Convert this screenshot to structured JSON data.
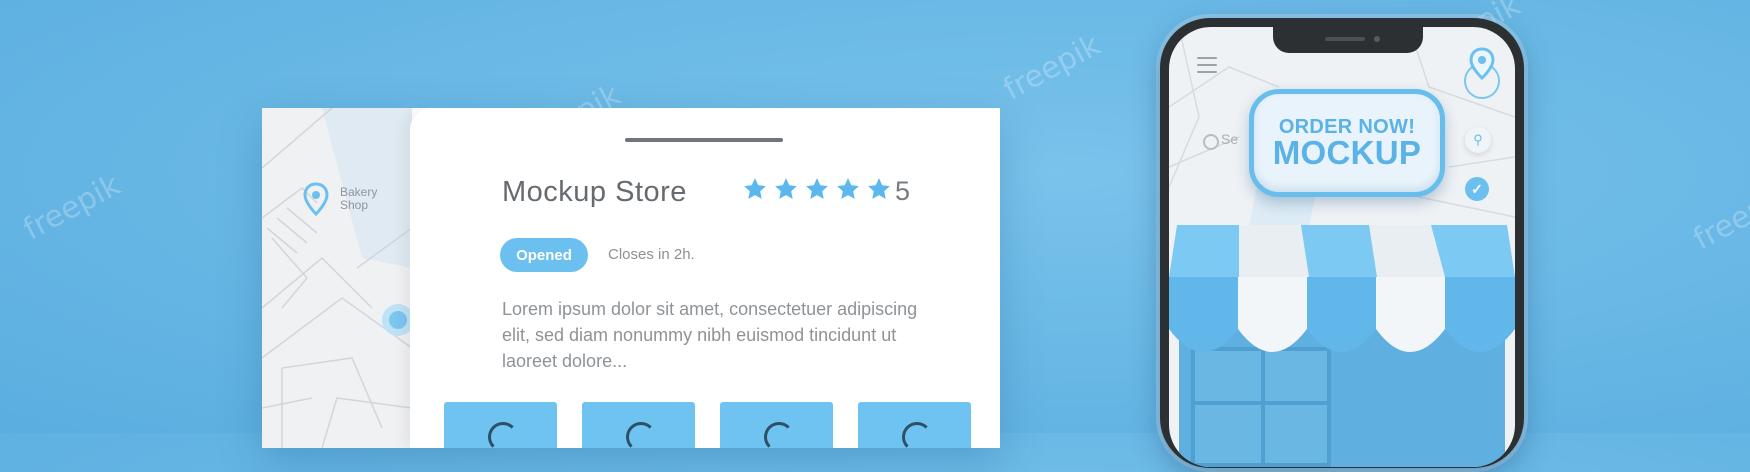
{
  "watermarks": [
    "freepik",
    "freepik",
    "freepik",
    "freepik",
    "freepik"
  ],
  "map": {
    "pin_icon": "location-pin-icon",
    "label": "Bakery Shop"
  },
  "store": {
    "name": "Mockup Store",
    "rating_value": "5",
    "stars_filled": 5,
    "stars_total": 5,
    "status_badge": "Opened",
    "closes_text": "Closes in 2h.",
    "description": "Lorem ipsum dolor sit amet, consectetuer adipiscing elit, sed diam nonummy nibh euismod tincidunt ut laoreet dolore...",
    "action_tiles": [
      "tile-1",
      "tile-2",
      "tile-3",
      "tile-4"
    ]
  },
  "phone": {
    "menu_icon": "hamburger-menu-icon",
    "location_icon": "location-pin-icon",
    "search_placeholder": "Se",
    "search_icon": "search-icon",
    "check_icon": "check-icon",
    "badge_line1": "ORDER NOW!",
    "badge_line2": "MOCKUP"
  },
  "colors": {
    "background": "#6bb9e6",
    "accent": "#6cc0ef",
    "awning_white": "#f3f6f8",
    "text_gray": "#666b70"
  }
}
